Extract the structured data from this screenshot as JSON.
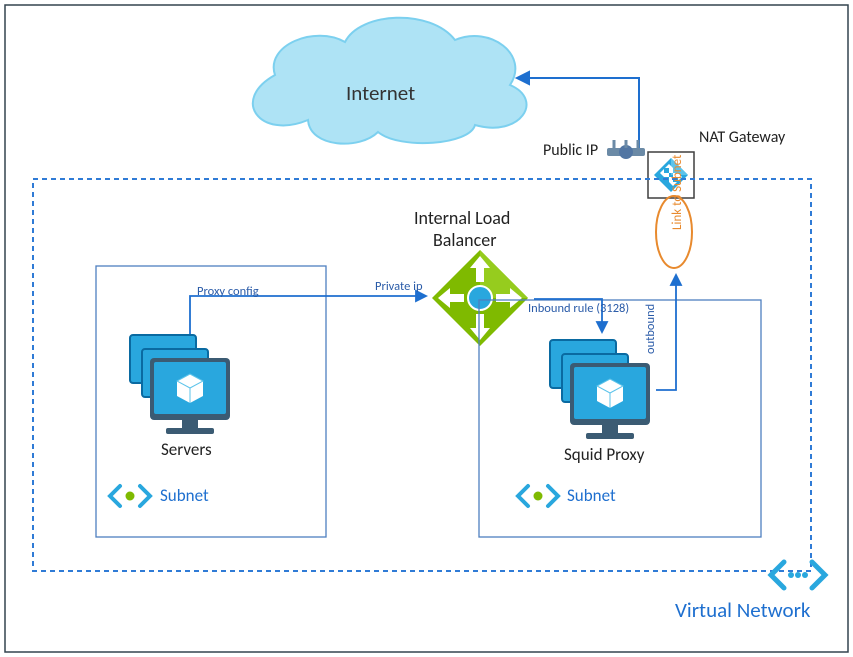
{
  "labels": {
    "internet": "Internet",
    "public_ip": "Public IP",
    "nat_gateway": "NAT Gateway",
    "link_to_subnet": "Link to Subnet",
    "internal_lb_1": "Internal Load",
    "internal_lb_2": "Balancer",
    "private_ip": "Private ip",
    "proxy_config": "Proxy config",
    "inbound_rule": "Inbound rule (3128)",
    "outbound": "outbound",
    "servers": "Servers",
    "squid_proxy": "Squid Proxy",
    "subnet_left": "Subnet",
    "subnet_right": "Subnet",
    "virtual_network": "Virtual Network"
  },
  "colors": {
    "azure_blue": "#1e6fcf",
    "sky": "#7cd0ef",
    "sky_fill": "#aee3f5",
    "vnet_dash": "#2f7bd6",
    "subnet_border": "#4e7fbf",
    "lb_green": "#7fba00",
    "orange": "#e88a2e",
    "vm_screen": "#29a7de",
    "vm_dark": "#0a6aa1"
  }
}
